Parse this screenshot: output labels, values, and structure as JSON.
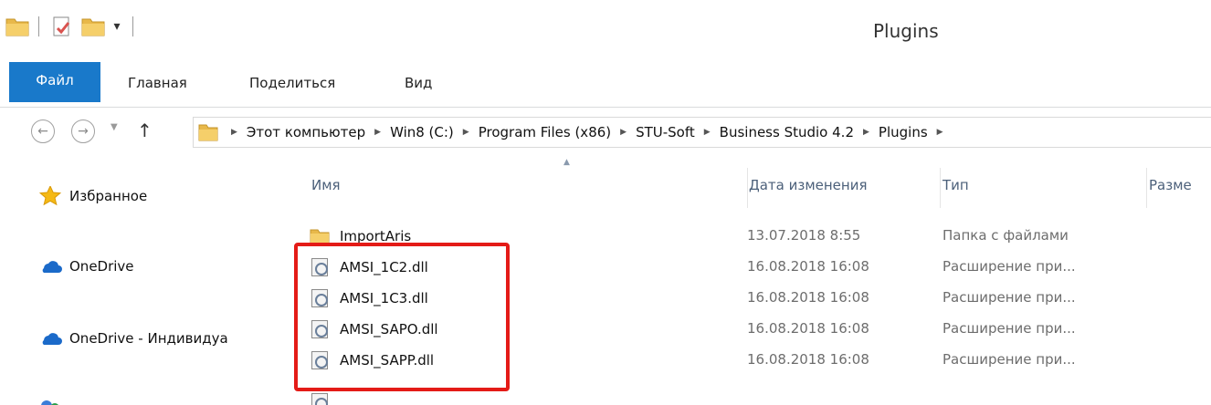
{
  "window": {
    "title": "Plugins"
  },
  "ribbon": {
    "tabs": [
      {
        "label": "Файл"
      },
      {
        "label": "Главная"
      },
      {
        "label": "Поделиться"
      },
      {
        "label": "Вид"
      }
    ]
  },
  "address": {
    "crumbs": [
      "Этот компьютер",
      "Win8 (C:)",
      "Program Files (x86)",
      "STU-Soft",
      "Business Studio 4.2",
      "Plugins"
    ]
  },
  "navpane": {
    "items": [
      {
        "label": "Избранное",
        "icon": "star-icon"
      },
      {
        "label": "OneDrive",
        "icon": "cloud-icon"
      },
      {
        "label": "OneDrive - Индивидуа",
        "icon": "cloud-icon"
      }
    ]
  },
  "columns": {
    "name": "Имя",
    "date": "Дата изменения",
    "type": "Тип",
    "size": "Разме"
  },
  "files": [
    {
      "name": "ImportAris",
      "date": "13.07.2018 8:55",
      "type": "Папка с файлами",
      "icon": "folder-icon"
    },
    {
      "name": "AMSI_1C2.dll",
      "date": "16.08.2018 16:08",
      "type": "Расширение при...",
      "icon": "dll-icon"
    },
    {
      "name": "AMSI_1C3.dll",
      "date": "16.08.2018 16:08",
      "type": "Расширение при...",
      "icon": "dll-icon"
    },
    {
      "name": "AMSI_SAPO.dll",
      "date": "16.08.2018 16:08",
      "type": "Расширение при...",
      "icon": "dll-icon"
    },
    {
      "name": "AMSI_SAPP.dll",
      "date": "16.08.2018 16:08",
      "type": "Расширение при...",
      "icon": "dll-icon"
    }
  ],
  "colors": {
    "file_tab": "#1979ca",
    "highlight": "#e41b17",
    "folder": "#e8b84a"
  }
}
